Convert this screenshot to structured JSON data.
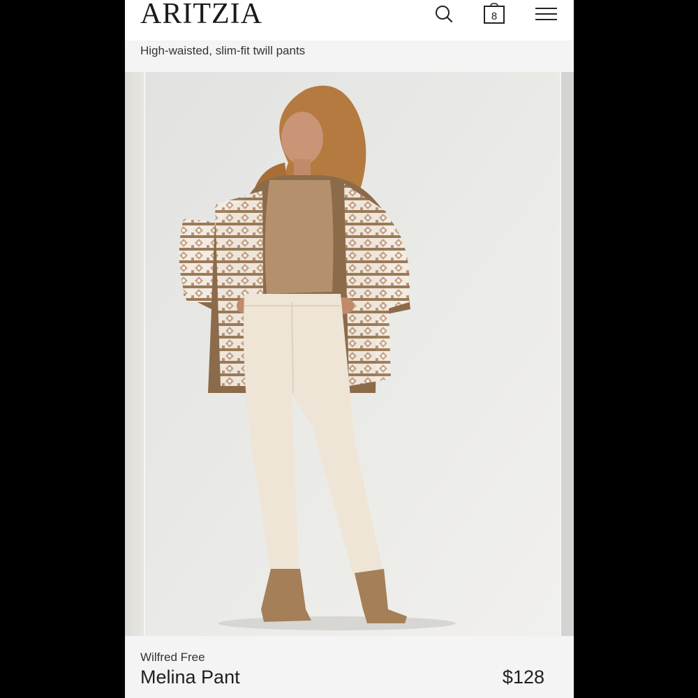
{
  "header": {
    "logo": "ARITZIA",
    "bag_count": "8",
    "icons": [
      "search-icon",
      "shopping-bag-icon",
      "hamburger-menu-icon"
    ]
  },
  "product": {
    "subtitle": "High-waisted, slim-fit twill pants",
    "brand": "Wilfred Free",
    "name": "Melina Pant",
    "price": "$128"
  },
  "colors": {
    "background": "#000000",
    "page": "#f4f4f4",
    "header": "#ffffff",
    "text": "#1f1f1f",
    "cardigan": "#8b6b4a",
    "pants": "#efe5d6",
    "boots": "#a57f58"
  }
}
